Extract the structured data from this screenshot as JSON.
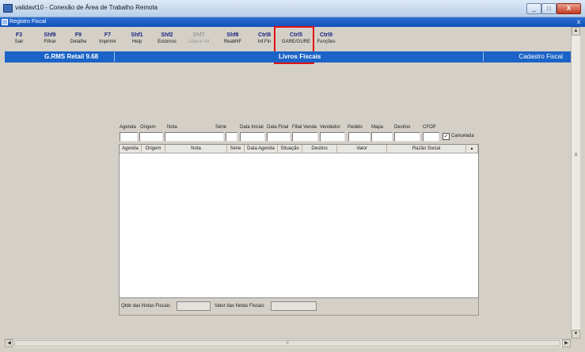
{
  "window": {
    "title": "validavt10 - Conexão de Área de Trabalho Remota",
    "minimize": "_",
    "maximize": "□",
    "close": "X"
  },
  "app": {
    "subtitle": "Registro Fiscal",
    "subtitle_close": "x"
  },
  "toolbar": [
    {
      "key": "F3",
      "label": "Sair",
      "enabled": true
    },
    {
      "key": "Shf9",
      "label": "Filtrar",
      "enabled": true
    },
    {
      "key": "F9",
      "label": "Detalhe",
      "enabled": true
    },
    {
      "key": "F7",
      "label": "Imprimir",
      "enabled": true
    },
    {
      "key": "Shf1",
      "label": "Help",
      "enabled": true
    },
    {
      "key": "Shf2",
      "label": "Estornos",
      "enabled": true
    },
    {
      "key": "Shf7",
      "label": "Liberar All",
      "enabled": false
    },
    {
      "key": "Shf8",
      "label": "ReabNF",
      "enabled": true
    },
    {
      "key": "Ctrl8",
      "label": "Inf.Fin",
      "enabled": true
    },
    {
      "key": "Ctrl5",
      "label": "GARE/GURE",
      "enabled": true
    },
    {
      "key": "Ctrl9",
      "label": "Funções",
      "enabled": true
    }
  ],
  "statusbar": {
    "left": "G.RMS Retail 9.68",
    "center": "Livros Fiscais",
    "right": "Cadastro Fiscal"
  },
  "filters": {
    "labels": [
      "Agenda",
      "Origem",
      "Nota",
      "Série",
      "Data Inicial",
      "Data Final",
      "Filial Venda",
      "Vendedor",
      "Pedido",
      "Mapa",
      "Destino",
      "CFOP"
    ],
    "checkbox_label": "Cancelada",
    "checkbox_checked": "✓"
  },
  "grid": {
    "columns": [
      "Agenda",
      "Origem",
      "Nota",
      "Série",
      "Data Agenda",
      "Situação",
      "Destino",
      "Valor",
      "Razão Social",
      "▴"
    ]
  },
  "footer": {
    "qtde_label": "Qtde das Notas Fiscais",
    "valor_label": "Valor das Notas Fiscais"
  },
  "scroll": {
    "up": "▲",
    "down": "▼",
    "left": "◀",
    "right": "▶",
    "grip": "≡"
  }
}
